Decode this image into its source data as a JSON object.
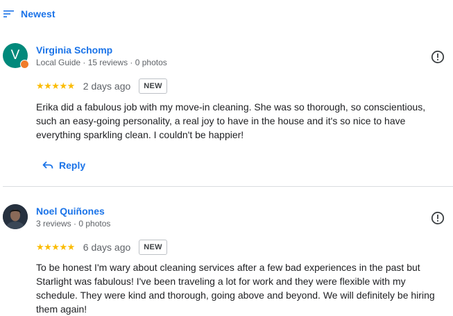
{
  "sort": {
    "label": "Newest"
  },
  "reviews": [
    {
      "avatar_letter": "V",
      "author": "Virginia Schomp",
      "meta": "Local Guide · 15 reviews · 0 photos",
      "stars": "★★★★★",
      "date": "2 days ago",
      "badge": "NEW",
      "text": "Erika did a fabulous job with my move-in cleaning. She was so thorough, so conscientious, such an easy-going personality, a real joy to have in the house and it's so nice to have everything sparkling clean. I couldn't be happier!",
      "reply_label": "Reply"
    },
    {
      "author": "Noel Quiñones",
      "meta": "3 reviews · 0 photos",
      "stars": "★★★★★",
      "date": "6 days ago",
      "badge": "NEW",
      "text": "To be honest I'm wary about cleaning services after a few bad experiences in the past but Starlight was fabulous! I've been traveling a lot for work and they were flexible with my schedule. They were kind and thorough, going above and beyond. We will definitely be hiring them again!"
    }
  ],
  "colors": {
    "accent": "#1a73e8",
    "star": "#fbbc04",
    "avatar_bg": "#00897b",
    "local_guide_badge": "#f07c2a"
  },
  "icons": {
    "sort": "sort-lines-icon",
    "more": "report-exclamation-icon",
    "reply": "reply-arrow-icon",
    "star": "star-icon"
  }
}
